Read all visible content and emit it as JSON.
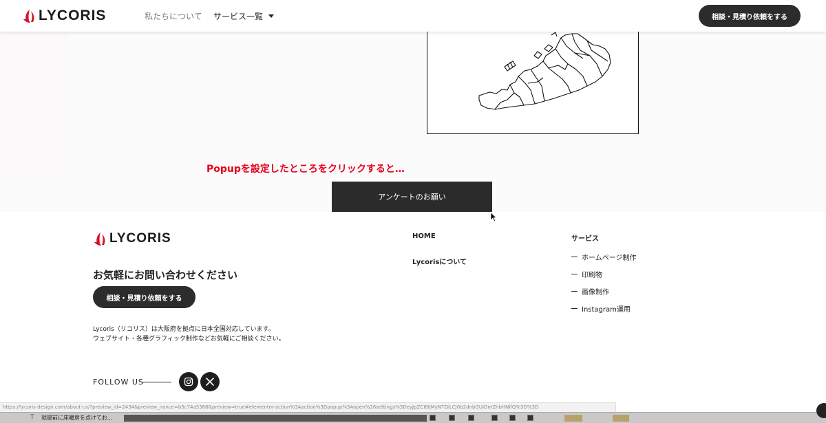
{
  "header": {
    "brand": "LYCORIS",
    "nav_about": "私たちについて",
    "nav_services": "サービス一覧",
    "cta": "相談・見積り依頼をする"
  },
  "main": {
    "annotation": "Popupを設定したところをクリックすると…",
    "survey_button": "アンケートのお願い"
  },
  "footer": {
    "brand": "LYCORIS",
    "heading": "お気軽にお問い合わせください",
    "cta": "相談・見積り依頼をする",
    "description_line1": "Lycoris（リコリス）は大阪府を拠点に日本全国対応しています。",
    "description_line2": "ウェブサイト・各種グラフィック制作などお気軽にご相談ください。",
    "follow_us": "FOLLOW US",
    "nav": [
      {
        "label": "HOME"
      },
      {
        "label": "Lycorisについて"
      }
    ],
    "services_title": "サービス",
    "services": [
      {
        "label": "ホームページ制作"
      },
      {
        "label": "印刷物"
      },
      {
        "label": "画像制作"
      },
      {
        "label": "Instagram運用"
      }
    ]
  },
  "status_bar": {
    "url": "https://lycoris-design.com/about-us/?preview_id=2434&preview_nonce=b5c74a5386&preview=true#elementor-action%3Aaction%3Dpopup%3Aopen%26settings%3DeyJpZCI6IjMyNTQiLCJ0b2dnbGUiOmZhbHNlfQ%3D%3D"
  },
  "taskbar": {
    "item_text": "就寝前に床暖房を点けてお..."
  },
  "colors": {
    "brand_red": "#d3142a",
    "dark_button": "#2c2c2c",
    "annotation_red": "#e5001a"
  }
}
